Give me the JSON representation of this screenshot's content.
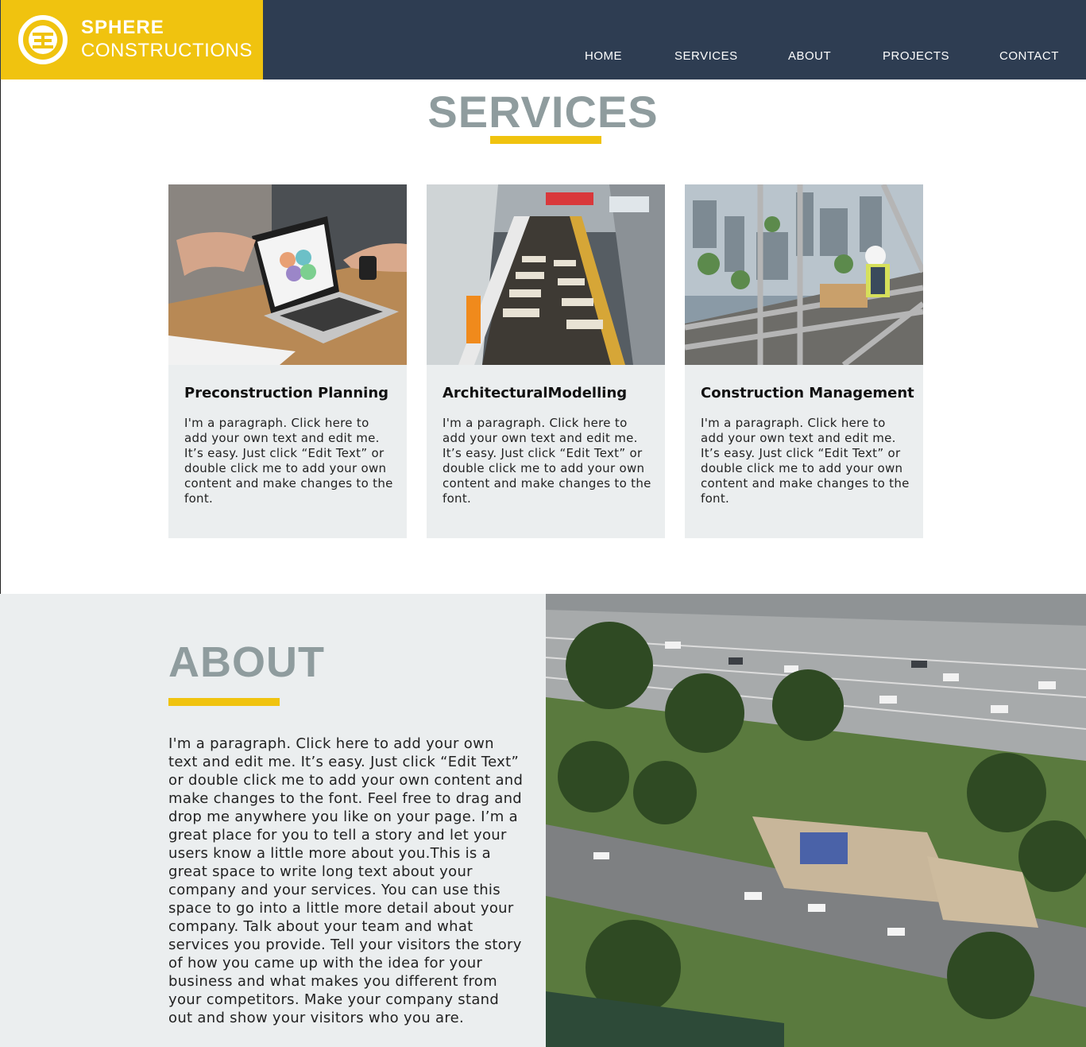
{
  "brand": {
    "line1": "SPHERE",
    "line2": "CONSTRUCTIONS",
    "primary_color": "#f0c30f",
    "header_color": "#2e3d52"
  },
  "nav": {
    "items": [
      "HOME",
      "SERVICES",
      "ABOUT",
      "PROJECTS",
      "CONTACT"
    ]
  },
  "services": {
    "title": "SERVICES",
    "cards": [
      {
        "title": "Preconstruction Planning",
        "text": "I'm a paragraph. Click here to add your own text and edit me. It’s easy. Just click “Edit Text” or double click me to add your own content and make changes to the font.",
        "image": "laptop-meeting-photo"
      },
      {
        "title": "ArchitecturalModelling",
        "text": "I'm a paragraph. Click here to add your own text and edit me. It’s easy. Just click “Edit Text” or double click me to add your own content and make changes to the font.",
        "image": "mall-interior-photo"
      },
      {
        "title": "Construction Management",
        "text": "I'm a paragraph. Click here to add your own text and edit me. It’s easy. Just click “Edit Text” or double click me to add your own content and make changes to the font.",
        "image": "scaffold-worker-photo"
      }
    ]
  },
  "about": {
    "title": "ABOUT",
    "text": "I'm a paragraph. Click here to add your own text and edit me. It’s easy. Just click “Edit Text” or double click me to add your own content and make changes to the font. Feel free to drag and drop me anywhere you like on your page. I’m a great place for you to tell a story and let your users know a little more about you.This is a great space to write long text about your company and your services. You can use this space to go into a little more detail about your company. Talk about your team and what services you provide. Tell your visitors the story of how you came up with the idea for your business and what makes you different from your competitors. Make your company stand out and show your visitors who you are.",
    "image": "aerial-highway-park-photo"
  }
}
